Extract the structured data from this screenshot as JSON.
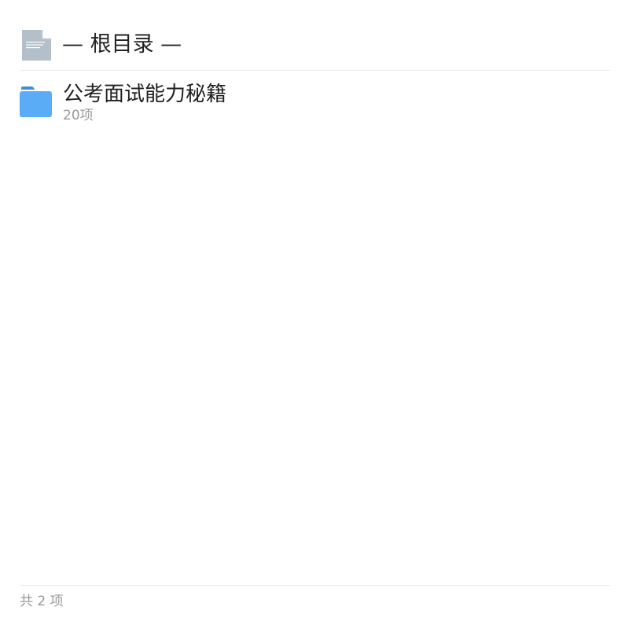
{
  "header": {
    "title": "— 根目录 —",
    "icon": "document-icon"
  },
  "items": [
    {
      "name": "公考面试能力秘籍",
      "count": "20项",
      "icon": "folder-icon"
    }
  ],
  "footer": {
    "summary": "共 2 项"
  },
  "colors": {
    "folder": "#5aacf7",
    "folder_tab": "#3d8fdb",
    "document": "#b4c0c9",
    "divider": "#ececec",
    "muted_text": "#999999"
  }
}
